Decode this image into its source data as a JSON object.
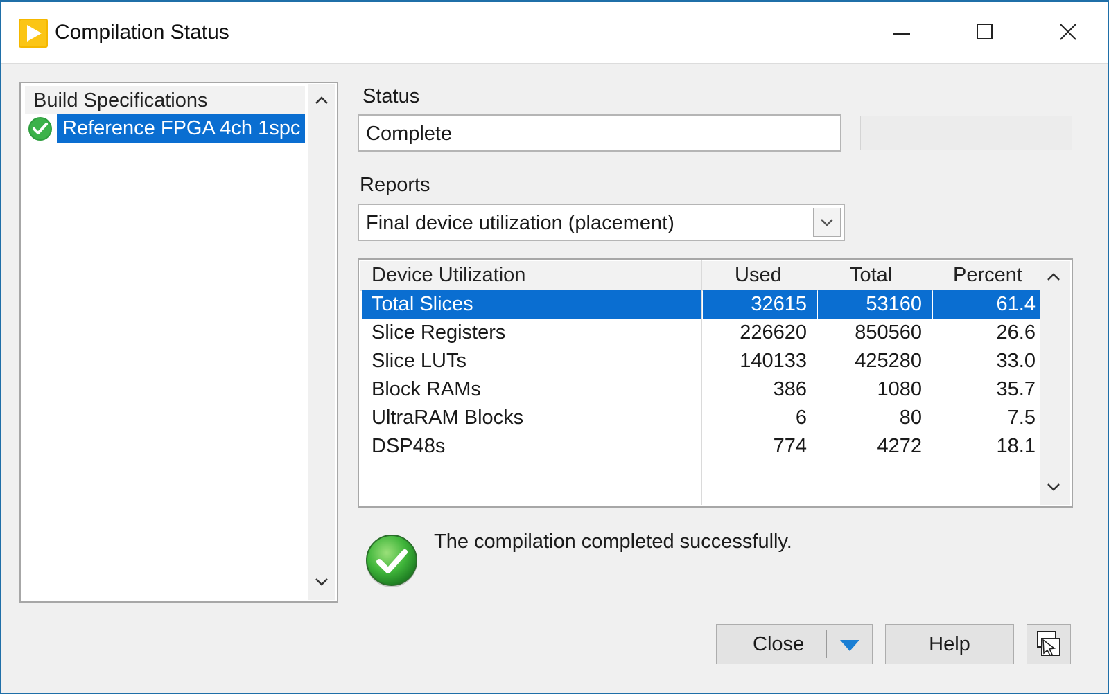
{
  "window": {
    "title": "Compilation Status",
    "controls": [
      "minimize",
      "maximize",
      "close"
    ]
  },
  "tree": {
    "header": "Build Specifications",
    "items": [
      {
        "label": "Reference FPGA 4ch 1spc",
        "status_icon": "check-circle-icon",
        "selected": true
      }
    ]
  },
  "status": {
    "label": "Status",
    "value": "Complete"
  },
  "reports": {
    "label": "Reports",
    "selected": "Final device utilization (placement)"
  },
  "table": {
    "columns": [
      "Device Utilization",
      "Used",
      "Total",
      "Percent"
    ],
    "rows": [
      {
        "name": "Total Slices",
        "used": "32615",
        "total": "53160",
        "percent": "61.4",
        "selected": true
      },
      {
        "name": "Slice Registers",
        "used": "226620",
        "total": "850560",
        "percent": "26.6"
      },
      {
        "name": "Slice LUTs",
        "used": "140133",
        "total": "425280",
        "percent": "33.0"
      },
      {
        "name": "Block RAMs",
        "used": "386",
        "total": "1080",
        "percent": "35.7"
      },
      {
        "name": "UltraRAM Blocks",
        "used": "6",
        "total": "80",
        "percent": "7.5"
      },
      {
        "name": "DSP48s",
        "used": "774",
        "total": "4272",
        "percent": "18.1"
      }
    ]
  },
  "message": {
    "text": "The compilation completed successfully.",
    "icon": "success-check-icon"
  },
  "buttons": {
    "close": "Close",
    "help": "Help"
  },
  "colors": {
    "selection": "#0a6ed1",
    "success": "#3cb24a",
    "accent_arrow": "#1a7fd4",
    "app_icon": "#f5b800"
  }
}
